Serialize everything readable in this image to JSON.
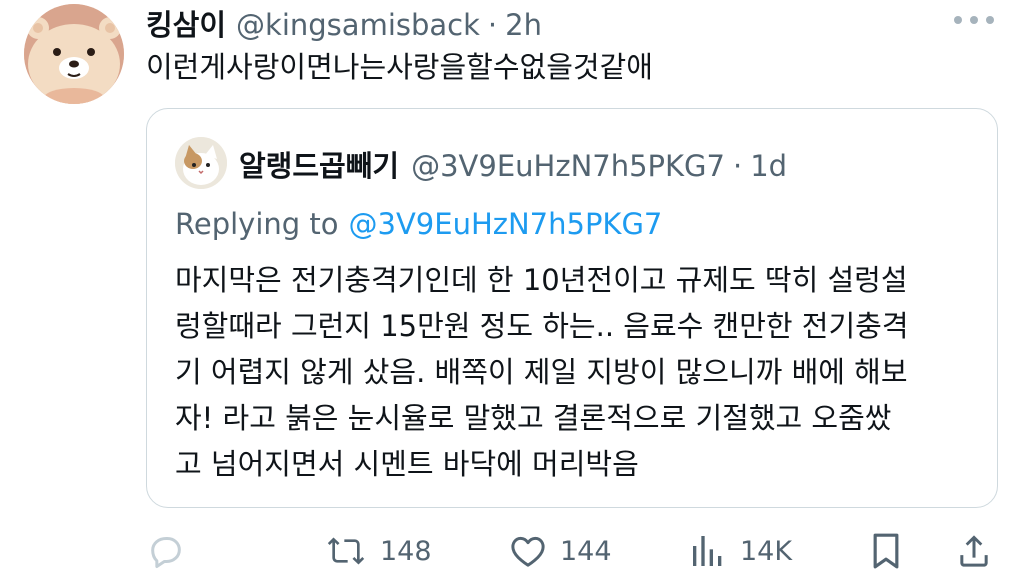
{
  "tweet": {
    "display_name": "킹삼이",
    "handle": "@kingsamisback",
    "separator": "·",
    "time": "2h",
    "text": "이런게사랑이면나는사랑을할수없을것같애",
    "avatar_icon": "bear-avatar-icon",
    "more_icon": "more-options-icon"
  },
  "quoted": {
    "display_name": "알랭드곱빼기",
    "handle": "@3V9EuHzN7h5PKG7",
    "separator": "·",
    "time": "1d",
    "replying_prefix": "Replying to",
    "replying_mention": "@3V9EuHzN7h5PKG7",
    "lines": [
      "마지막은 전기충격기인데 한 10년전이고 규제도 딱히 설렁설",
      "렁할때라 그런지 15만원 정도 하는.. 음료수 캔만한 전기충격",
      "기 어렵지 않게 샀음. 배쪽이 제일 지방이 많으니까 배에 해보",
      "자! 라고 붉은 눈시율로 말했고 결론적으로 기절했고 오줌쌌",
      "고 넘어지면서 시멘트 바닥에 머리박음"
    ]
  },
  "actions": {
    "reply_icon": "reply-icon",
    "retweet_count": "148",
    "like_count": "144",
    "views_count": "14K",
    "bookmark_icon": "bookmark-icon",
    "share_icon": "share-icon"
  },
  "colors": {
    "text": "#0f1419",
    "secondary": "#536471",
    "link": "#1d9bf0",
    "border": "#cfd9de",
    "reply_faded": "#c4cfd6"
  }
}
